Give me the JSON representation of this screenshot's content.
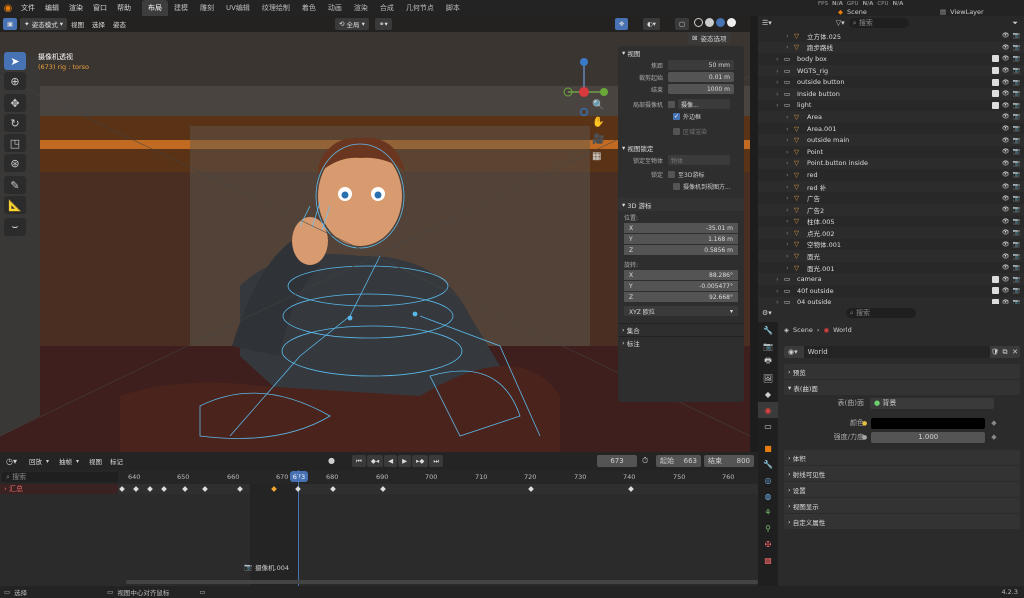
{
  "topbar": {
    "menus": [
      "文件",
      "编辑",
      "渲染",
      "窗口",
      "帮助"
    ],
    "workspaces": [
      "布局",
      "建模",
      "雕刻",
      "UV编辑",
      "纹理绘制",
      "着色",
      "动画",
      "渲染",
      "合成",
      "几何节点",
      "脚本"
    ],
    "active_workspace": "布局",
    "stats": {
      "fps_label": "FPS",
      "fps_value": "N/A",
      "gpu_label": "GPU",
      "gpu_value": "N/A",
      "cpu_label": "CPU",
      "cpu_value": "N/A"
    },
    "scene": "Scene",
    "view_layer": "ViewLayer"
  },
  "viewport": {
    "mode": "姿态模式",
    "menus": [
      "视图",
      "选择",
      "姿态"
    ],
    "transform": "全局",
    "overlay_title": "摄像机透视",
    "overlay_sub": "(673) rig : torso",
    "pose_options": "姿态选项"
  },
  "npanel": {
    "view_section": "视图",
    "focal_label": "焦距",
    "focal_value": "50 mm",
    "clip_start_label": "裁剪起始",
    "clip_start_value": "0.01 m",
    "clip_end_label": "结束",
    "clip_end_value": "1000 m",
    "local_cam_label": "局部摄像机",
    "local_cam_value": "摄像...",
    "outline_label": "外边框",
    "region_render_label": "区域渲染",
    "view_lock_section": "视图锁定",
    "lock_obj_label": "锁定至物体",
    "lock_obj_value": "物体",
    "lock_label": "锁定",
    "lock_3d_cursor": "至3D游标",
    "lock_camera": "摄像机到视图方...",
    "cursor_section": "3D 游标",
    "location_label": "位置:",
    "loc_x": "-35.01 m",
    "loc_y": "1.168 m",
    "loc_z": "0.5856 m",
    "rotation_label": "旋转:",
    "rot_x": "88.286°",
    "rot_y": "-0.005477°",
    "rot_z": "92.668°",
    "rotation_mode": "XYZ 欧拉",
    "collections_section": "集合",
    "annotations_section": "标注"
  },
  "timeline": {
    "menus": [
      "回放",
      "抽帧",
      "视图",
      "标记"
    ],
    "current_frame": "673",
    "start_label": "起始",
    "start_value": "663",
    "end_label": "结束",
    "end_value": "800",
    "search_placeholder": "搜索",
    "summary_label": "汇总",
    "ticks": [
      "640",
      "650",
      "660",
      "670",
      "680",
      "690",
      "700",
      "710",
      "720",
      "730",
      "740",
      "750",
      "760"
    ],
    "marker_label": "摄像机.004"
  },
  "status": {
    "select": "选择",
    "center_view": "视图中心对齐鼠标",
    "version": "4.2.3"
  },
  "outliner": {
    "search_placeholder": "搜索",
    "items": [
      {
        "name": "立方体.025",
        "indent": 2
      },
      {
        "name": "跑步路线",
        "indent": 2
      },
      {
        "name": "body box",
        "indent": 1
      },
      {
        "name": "WGTS_rig",
        "indent": 1
      },
      {
        "name": "outside button",
        "indent": 1
      },
      {
        "name": "Inside button",
        "indent": 1
      },
      {
        "name": "light",
        "indent": 1
      },
      {
        "name": "Area",
        "indent": 2
      },
      {
        "name": "Area.001",
        "indent": 2
      },
      {
        "name": "outside main",
        "indent": 2
      },
      {
        "name": "Point",
        "indent": 2
      },
      {
        "name": "Point.button inside",
        "indent": 2
      },
      {
        "name": "red",
        "indent": 2
      },
      {
        "name": "red 补",
        "indent": 2
      },
      {
        "name": "广告",
        "indent": 2
      },
      {
        "name": "广告2",
        "indent": 2
      },
      {
        "name": "柱体.005",
        "indent": 2
      },
      {
        "name": "点光.002",
        "indent": 2
      },
      {
        "name": "空物体.001",
        "indent": 2
      },
      {
        "name": "面光",
        "indent": 2
      },
      {
        "name": "面光.001",
        "indent": 2
      },
      {
        "name": "camera",
        "indent": 1
      },
      {
        "name": "40f outside",
        "indent": 1
      },
      {
        "name": "04 outside",
        "indent": 1
      }
    ]
  },
  "properties": {
    "search_placeholder": "搜索",
    "breadcrumb_scene": "Scene",
    "breadcrumb_world": "World",
    "world_name": "World",
    "preview": "预览",
    "surface": "表(曲)面",
    "surface_label": "表(曲)面",
    "surface_value": "背景",
    "color_label": "颜色",
    "strength_label": "强度/力度",
    "strength_value": "1.000",
    "volume": "体积",
    "ray_visibility": "射线可见性",
    "settings": "设置",
    "viewport_display": "视图显示",
    "custom_props": "自定义属性"
  }
}
